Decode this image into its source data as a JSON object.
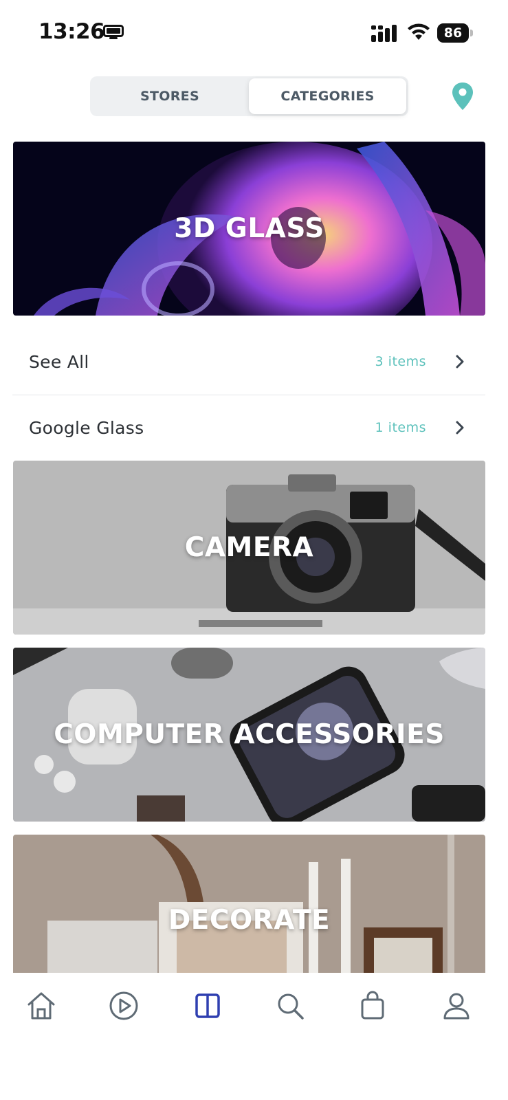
{
  "status_bar": {
    "time": "13:26",
    "battery": "86",
    "battery_level": 0.86
  },
  "segment": {
    "stores_label": "STORES",
    "categories_label": "CATEGORIES",
    "selected": "CATEGORIES"
  },
  "categories": [
    {
      "title": "3D GLASS"
    },
    {
      "title": "CAMERA"
    },
    {
      "title": "COMPUTER ACCESSORIES"
    },
    {
      "title": "DECORATE"
    }
  ],
  "subcategories": [
    {
      "name": "See All",
      "count": "3 items"
    },
    {
      "name": "Google Glass",
      "count": "1 items"
    }
  ],
  "colors": {
    "accent": "#5cc1bb",
    "active_nav": "#2f3fb0",
    "nav_inactive": "#5f6b75"
  },
  "icons": [
    "screen-mirroring-icon",
    "cellular-signal-icon",
    "wifi-icon",
    "battery-icon",
    "location-pin-icon",
    "chevron-right-icon",
    "home-icon",
    "play-icon",
    "catalog-icon",
    "search-icon",
    "shopping-bag-icon",
    "profile-icon"
  ],
  "bottom_nav": {
    "active": "catalog"
  }
}
